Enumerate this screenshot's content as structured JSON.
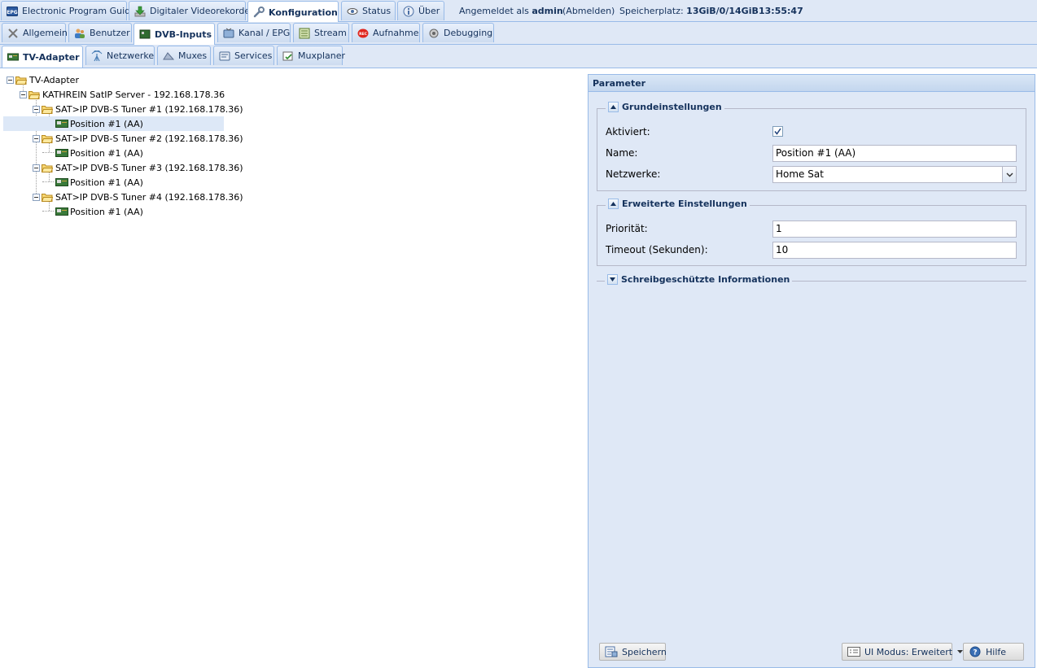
{
  "top_tabs": [
    {
      "label": "Electronic Program Guide",
      "icon": "epg-icon"
    },
    {
      "label": "Digitaler Videorekorder",
      "icon": "download-icon"
    },
    {
      "label": "Konfiguration",
      "icon": "wrench-icon"
    },
    {
      "label": "Status",
      "icon": "eye-icon"
    },
    {
      "label": "Über",
      "icon": "info-icon"
    }
  ],
  "header": {
    "login_prefix": "Angemeldet als",
    "user": "admin",
    "logout": "(Abmelden)",
    "storage_label": "Speicherplatz:",
    "storage_value": "13GiB/0/14GiB",
    "time": "13:55:47"
  },
  "config_tabs": [
    {
      "label": "Allgemein",
      "icon": "tools-icon"
    },
    {
      "label": "Benutzer",
      "icon": "users-icon"
    },
    {
      "label": "DVB-Inputs",
      "icon": "dvb-card-icon"
    },
    {
      "label": "Kanal / EPG",
      "icon": "tv-icon"
    },
    {
      "label": "Stream",
      "icon": "stream-icon"
    },
    {
      "label": "Aufnahme",
      "icon": "rec-icon"
    },
    {
      "label": "Debugging",
      "icon": "bug-icon"
    }
  ],
  "dvb_tabs": [
    {
      "label": "TV-Adapter",
      "icon": "tv-adapter-icon"
    },
    {
      "label": "Netzwerke",
      "icon": "antenna-icon"
    },
    {
      "label": "Muxes",
      "icon": "muxes-icon"
    },
    {
      "label": "Services",
      "icon": "services-icon"
    },
    {
      "label": "Muxplaner",
      "icon": "scheduler-icon"
    }
  ],
  "tree": {
    "root": "TV-Adapter",
    "server": "KATHREIN SatIP Server - 192.168.178.36",
    "tuners": [
      {
        "label": "SAT>IP DVB-S Tuner #1 (192.168.178.36)",
        "child": "Position #1 (AA)"
      },
      {
        "label": "SAT>IP DVB-S Tuner #2 (192.168.178.36)",
        "child": "Position #1 (AA)"
      },
      {
        "label": "SAT>IP DVB-S Tuner #3 (192.168.178.36)",
        "child": "Position #1 (AA)"
      },
      {
        "label": "SAT>IP DVB-S Tuner #4 (192.168.178.36)",
        "child": "Position #1 (AA)"
      }
    ]
  },
  "panel": {
    "title": "Parameter",
    "basic": {
      "legend": "Grundeinstellungen",
      "enabled_label": "Aktiviert:",
      "enabled": true,
      "name_label": "Name:",
      "name_value": "Position #1 (AA)",
      "networks_label": "Netzwerke:",
      "networks_value": "Home Sat"
    },
    "advanced": {
      "legend": "Erweiterte Einstellungen",
      "priority_label": "Priorität:",
      "priority_value": "1",
      "timeout_label": "Timeout (Sekunden):",
      "timeout_value": "10"
    },
    "readonly": {
      "legend": "Schreibgeschützte Informationen"
    },
    "save_label": "Speichern",
    "ui_mode_label": "UI Modus: Erweitert",
    "help_label": "Hilfe"
  },
  "colors": {
    "accent": "#15325c",
    "tabbar_bg": "#dfe8f6",
    "border": "#99bbe8",
    "selection": "#dde8f7"
  }
}
